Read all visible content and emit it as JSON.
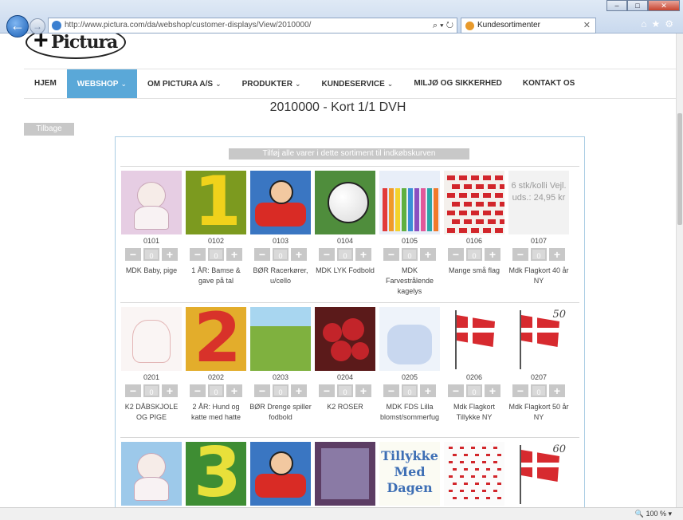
{
  "browser": {
    "url": "http://www.pictura.com/da/webshop/customer-displays/View/2010000/",
    "url_domain": "pictura.com",
    "tab_title": "Kundesortimenter",
    "zoom": "100 %"
  },
  "site": {
    "logo_text": "Pictura",
    "nav": [
      {
        "label": "HJEM",
        "caret": false,
        "active": false
      },
      {
        "label": "WEBSHOP",
        "caret": true,
        "active": true
      },
      {
        "label": "OM PICTURA A/S",
        "caret": true,
        "active": false
      },
      {
        "label": "PRODUKTER",
        "caret": true,
        "active": false
      },
      {
        "label": "KUNDESERVICE",
        "caret": true,
        "active": false
      },
      {
        "label": "MILJØ OG SIKKERHED",
        "caret": false,
        "active": false
      },
      {
        "label": "KONTAKT OS",
        "caret": false,
        "active": false
      }
    ]
  },
  "page": {
    "title": "2010000 - Kort 1/1 DVH",
    "back_label": "Tilbage",
    "add_all_label": "Tilføj alle varer i dette sortiment til indkøbskurven"
  },
  "products_row1": [
    {
      "code": "0101",
      "qty": "0",
      "name": "MDK Baby, pige",
      "art": "baby-pink"
    },
    {
      "code": "0102",
      "qty": "0",
      "name": "1 ÅR: Bamse & gave på tal",
      "art": "number-1"
    },
    {
      "code": "0103",
      "qty": "0",
      "name": "BØR Racerkører, u/cello",
      "art": "race"
    },
    {
      "code": "0104",
      "qty": "0",
      "name": "MDK LYK Fodbold",
      "art": "football"
    },
    {
      "code": "0105",
      "qty": "0",
      "name": "MDK Farvestrålende kagelys",
      "art": "candles"
    },
    {
      "code": "0106",
      "qty": "0",
      "name": "Mange små flag",
      "art": "flags"
    },
    {
      "code": "0107",
      "qty": "0",
      "name": "Mdk Flagkort 40 år NY",
      "art": "text-overlay",
      "overlay": "6 stk/kolli Vejl. uds.: 24,95 kr"
    }
  ],
  "products_row2": [
    {
      "code": "0201",
      "qty": "0",
      "name": "K2 DÅBSKJOLE OG PIGE",
      "art": "sketch"
    },
    {
      "code": "0202",
      "qty": "0",
      "name": "2 ÅR: Hund og katte med hatte",
      "art": "number-2"
    },
    {
      "code": "0203",
      "qty": "0",
      "name": "BØR Drenge spiller fodbold",
      "art": "soccer"
    },
    {
      "code": "0204",
      "qty": "0",
      "name": "K2 ROSER",
      "art": "roses"
    },
    {
      "code": "0205",
      "qty": "0",
      "name": "MDK FDS Lilla blomst/sommerfug",
      "art": "lilac"
    },
    {
      "code": "0206",
      "qty": "0",
      "name": "Mdk Flagkort Tillykke NY",
      "art": "flagpole"
    },
    {
      "code": "0207",
      "qty": "0",
      "name": "Mdk Flagkort 50 år NY",
      "art": "flagpole-50",
      "age": "50"
    }
  ],
  "products_row3": [
    {
      "art": "baby-blue"
    },
    {
      "art": "number-3"
    },
    {
      "art": "coolfyr"
    },
    {
      "art": "mosaic"
    },
    {
      "art": "tillykke",
      "text": "Tillykke Med Dagen"
    },
    {
      "art": "dots"
    },
    {
      "art": "flagpole-60",
      "age": "60"
    }
  ],
  "icons": {
    "back": "arrow-left-icon",
    "forward": "arrow-right-icon",
    "minus": "minus-icon",
    "plus": "plus-icon",
    "zoom": "magnifier-icon"
  }
}
